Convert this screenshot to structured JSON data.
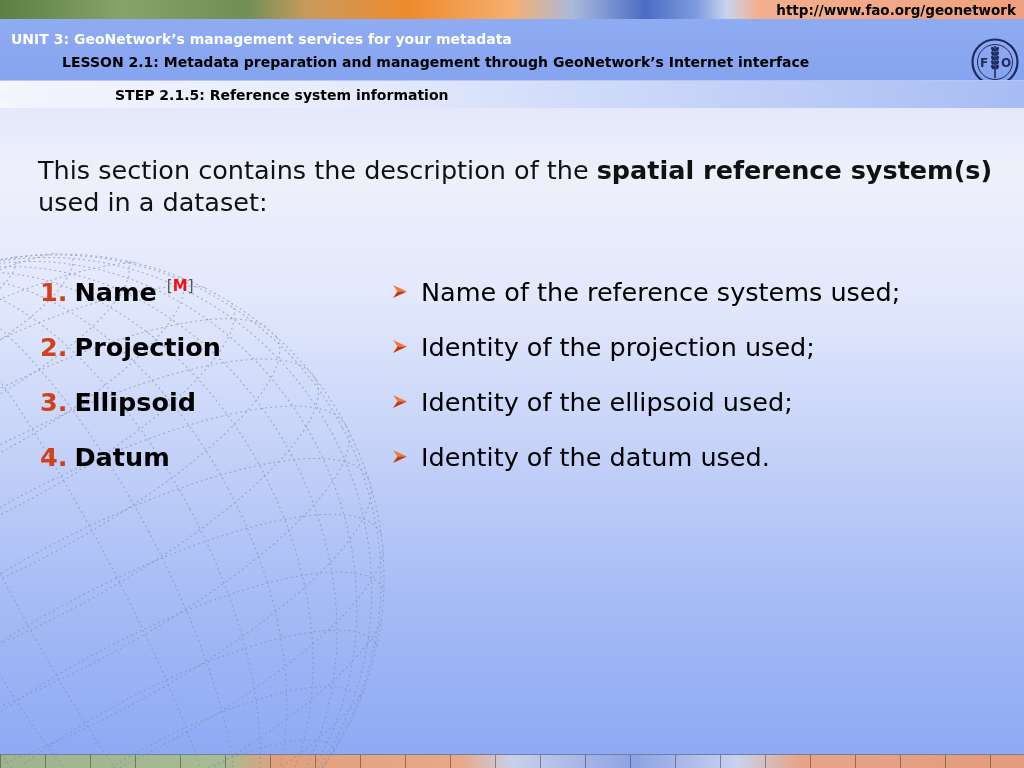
{
  "header": {
    "url": "http://www.fao.org/geonetwork",
    "unit": "UNIT 3: GeoNetwork’s management services for your metadata",
    "lesson": "LESSON 2.1: Metadata preparation and management through GeoNetwork’s Internet interface",
    "logo": {
      "left": "F",
      "right": "O"
    }
  },
  "step": "STEP 2.1.5: Reference system information",
  "intro": "This section contains the description of the **spatial reference system(s)** used in a dataset:",
  "items": [
    {
      "number": "1.",
      "label": "Name",
      "mark": {
        "open": "[",
        "letter": "M",
        "close": "]"
      },
      "description": "Name of the reference systems used;"
    },
    {
      "number": "2.",
      "label": "Projection",
      "description": "Identity of the projection used;"
    },
    {
      "number": "3.",
      "label": "Ellipsoid",
      "description": "Identity of the ellipsoid used;"
    },
    {
      "number": "4.",
      "label": "Datum",
      "description": "Identity of the datum used."
    }
  ]
}
